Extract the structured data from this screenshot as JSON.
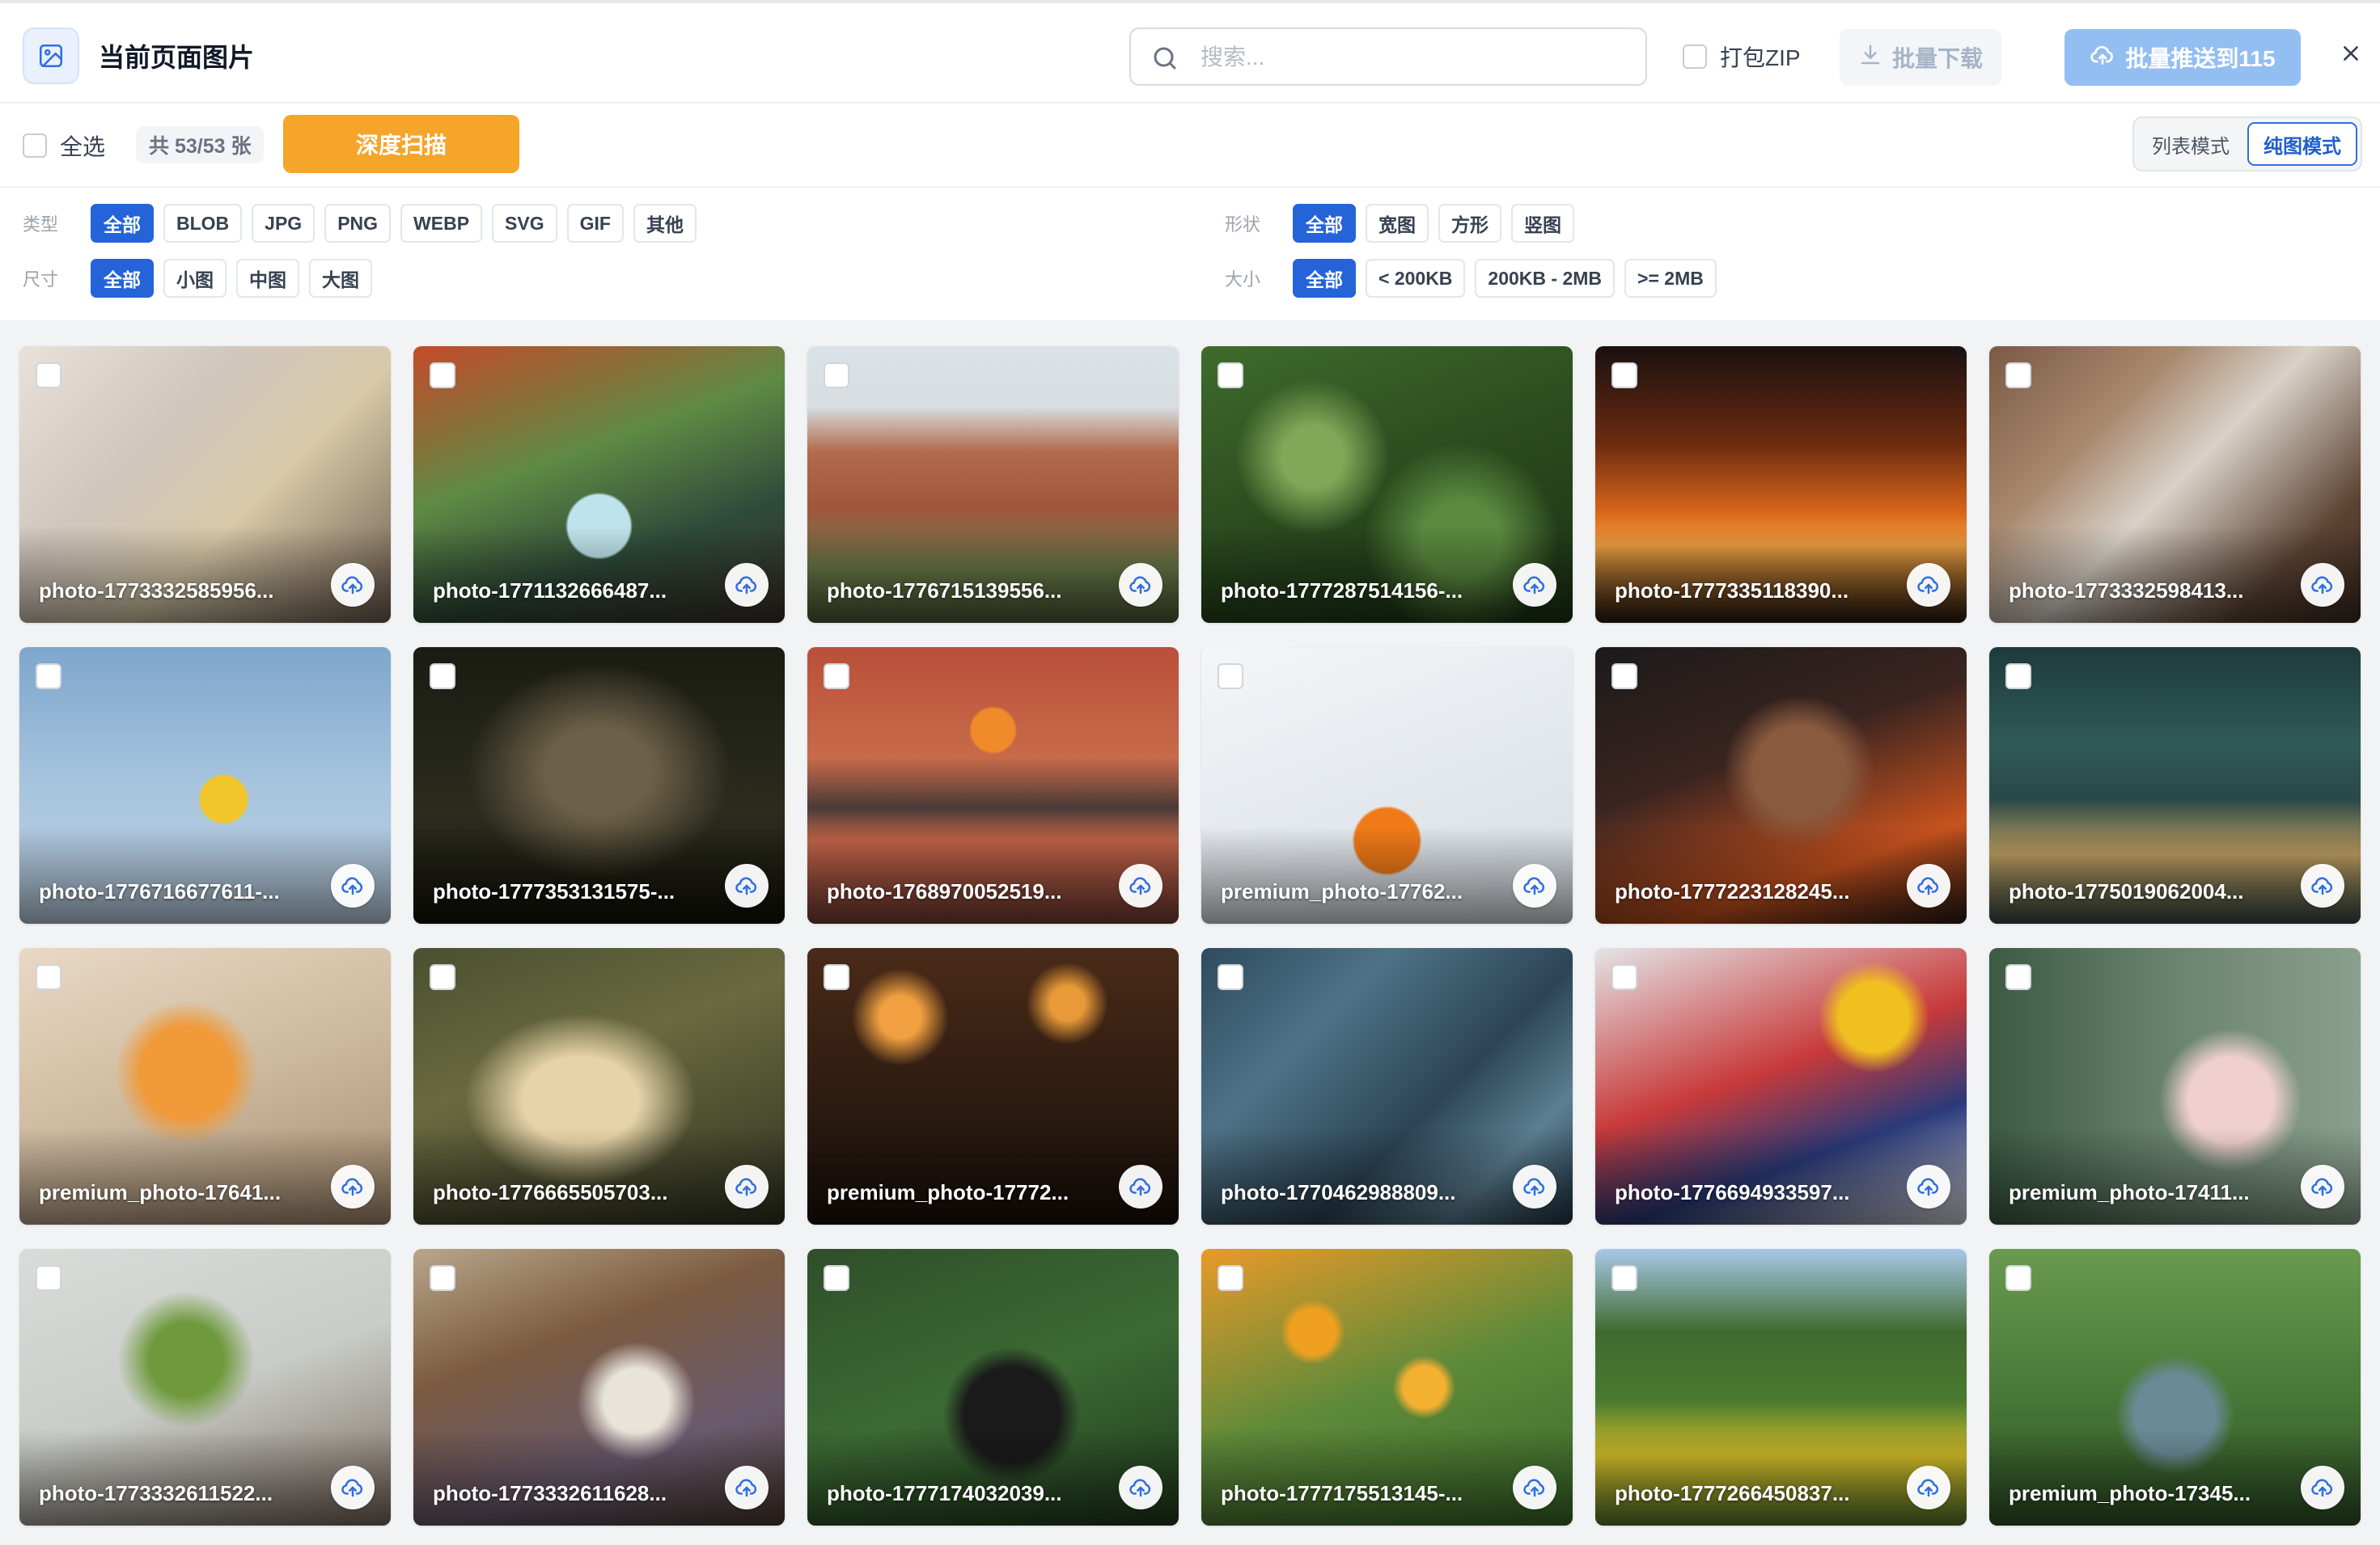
{
  "header": {
    "title": "当前页面图片",
    "logo_icon": "image-icon",
    "search_placeholder": "搜索...",
    "search_value": "",
    "zip_label": "打包ZIP",
    "download_label": "批量下载",
    "push_label": "批量推送到115",
    "close_icon": "close-icon"
  },
  "toolbar": {
    "select_all_label": "全选",
    "count_label": "共 53/53 张",
    "deep_scan_label": "深度扫描",
    "mode_list_label": "列表模式",
    "mode_grid_label": "纯图模式"
  },
  "filters": {
    "type": {
      "label": "类型",
      "options": [
        "全部",
        "BLOB",
        "JPG",
        "PNG",
        "WEBP",
        "SVG",
        "GIF",
        "其他"
      ],
      "selected": "全部"
    },
    "shape": {
      "label": "形状",
      "options": [
        "全部",
        "宽图",
        "方形",
        "竖图"
      ],
      "selected": "全部"
    },
    "dimension": {
      "label": "尺寸",
      "options": [
        "全部",
        "小图",
        "中图",
        "大图"
      ],
      "selected": "全部"
    },
    "filesize": {
      "label": "大小",
      "options": [
        "全部",
        "< 200KB",
        "200KB - 2MB",
        ">= 2MB"
      ],
      "selected": "全部"
    }
  },
  "colors": {
    "primary": "#2563d8",
    "orange": "#f5a52a",
    "push_button": "#93bef2"
  },
  "images": [
    {
      "name": "photo-1773332585956...",
      "bg": "linear-gradient(135deg,#e9e1da 0%,#cfc6bd 35%,#d8c9a8 60%,#6c5b4e 100%)"
    },
    {
      "name": "photo-1771132666487...",
      "bg": "radial-gradient(circle at 50% 65%,#bfe3ec 0 12%,transparent 13%),linear-gradient(160deg,#c44a2a 0%,#5f8a44 40%,#2e4a3a 70%,#3a2f26 100%)"
    },
    {
      "name": "photo-1776715139556...",
      "bg": "linear-gradient(180deg,#dbe3e8 0%,#d7dde0 22%,#b26b4c 38%,#a1563c 58%,#6b7b4a 80%,#4e5c36 100%)"
    },
    {
      "name": "photo-1777287514156-...",
      "bg": "radial-gradient(circle at 30% 40%,#7fa858 0 10%,transparent 25%),radial-gradient(circle at 70% 70%,#5b8a3f 0 12%,transparent 30%),linear-gradient(160deg,#3f6b2c 0%,#2a4a1e 50%,#1b3315 100%)"
    },
    {
      "name": "photo-1777335118390...",
      "bg": "linear-gradient(180deg,#1a1110 0%,#6b2a10 35%,#d9651a 60%,#f0a040 72%,#2a1a10 100%)"
    },
    {
      "name": "photo-1773332598413...",
      "bg": "linear-gradient(135deg,#7a5a44 0%,#a98a70 30%,#d9d2c8 50%,#5d4433 80%,#3b2a20 100%)"
    },
    {
      "name": "photo-1776716677611-...",
      "bg": "radial-gradient(circle at 55% 55%,#f1c62a 0 9%,transparent 10%),linear-gradient(180deg,#7ea6cc 0%,#a7c4de 50%,#bcd1e3 100%)"
    },
    {
      "name": "photo-1777353131575-...",
      "bg": "radial-gradient(ellipse at 50% 45%,#6d6048 0 20%,transparent 50%),linear-gradient(180deg,#1a1c12 0%,#2b2c1e 60%,#121208 100%)"
    },
    {
      "name": "photo-1768970052519...",
      "bg": "radial-gradient(circle at 50% 30%,#f08a2a 0 8%,transparent 9%),linear-gradient(180deg,#b9503a 0%,#c86a4a 40%,#4a3a38 58%,#c26448 70%,#7a3f36 100%)"
    },
    {
      "name": "premium_photo-17762...",
      "bg": "radial-gradient(circle at 50% 70%,#f07a18 0 12%,transparent 13%),linear-gradient(160deg,#f4f6f8 0%,#e4e9ee 50%,#d6dde3 100%)"
    },
    {
      "name": "photo-1777223128245...",
      "bg": "radial-gradient(circle at 55% 45%,#8a5a3e 0 18%,transparent 30%),linear-gradient(160deg,#1c1a1a 0%,#3a2420 40%,#c8521e 75%,#2a1a14 100%)"
    },
    {
      "name": "photo-1775019062004...",
      "bg": "linear-gradient(180deg,#1e3a3c 0%,#2f5a58 35%,#2a4848 55%,#c0a060 75%,#3a4a46 100%)"
    },
    {
      "name": "premium_photo-17641...",
      "bg": "radial-gradient(circle at 45% 45%,#f09a3a 0 18%,transparent 28%),linear-gradient(160deg,#e9d9c4 0%,#cdb99e 50%,#a68c70 100%)"
    },
    {
      "name": "photo-1776665505703...",
      "bg": "radial-gradient(ellipse at 45% 55%,#e7d3a8 0 20%,transparent 40%),linear-gradient(160deg,#4a5030 0%,#6a6a40 40%,#2f3320 100%)"
    },
    {
      "name": "premium_photo-17772...",
      "bg": "radial-gradient(circle at 25% 25%,#f0a040 0 6%,transparent 14%),radial-gradient(circle at 70% 20%,#e89a38 0 5%,transparent 12%),linear-gradient(180deg,#4a2a18 0%,#2a1a10 60%,#1a100a 100%)"
    },
    {
      "name": "photo-1770462988809...",
      "bg": "linear-gradient(135deg,#2e4a5e 0%,#4e7286 30%,#2c4556 60%,#5c7f92 80%,#1f3444 100%)"
    },
    {
      "name": "photo-1776694933597...",
      "bg": "radial-gradient(circle at 75% 25%,#f0c020 0 10%,transparent 16%),linear-gradient(160deg,#e4e4e6 0%,#c83a3a 45%,#2a3a7a 70%,#d9d9dc 100%)"
    },
    {
      "name": "premium_photo-17411...",
      "bg": "radial-gradient(circle at 65% 55%,#efcfcf 0 15%,transparent 25%),linear-gradient(90deg,#3c5a44 0%,#6a8470 50%,#8aa08e 100%)"
    },
    {
      "name": "photo-1773332611522...",
      "bg": "radial-gradient(circle at 45% 40%,#6e9a3c 0 14%,transparent 26%),linear-gradient(160deg,#d9dcd8 0%,#c9ccc7 50%,#7a6b5e 100%)"
    },
    {
      "name": "photo-1773332611628...",
      "bg": "radial-gradient(circle at 60% 55%,#e9e4da 0 12%,transparent 22%),linear-gradient(160deg,#b9a68a 0%,#7a5a40 35%,#6a5a6e 70%,#4a3a30 100%)"
    },
    {
      "name": "photo-1777174032039...",
      "bg": "radial-gradient(circle at 55% 60%,#1a1a1a 0 18%,transparent 26%),linear-gradient(160deg,#2f4f2a 0%,#3c6a34 50%,#1f3a1c 100%)"
    },
    {
      "name": "photo-1777175513145-...",
      "bg": "radial-gradient(circle at 30% 30%,#f0a020 0 7%,transparent 10%),radial-gradient(circle at 60% 50%,#f4b030 0 8%,transparent 12%),linear-gradient(160deg,#e89a28 0%,#5e8a3a 50%,#3a6a2a 100%)"
    },
    {
      "name": "photo-1777266450837...",
      "bg": "linear-gradient(180deg,#a8c8e8 0%,#3f6a2e 30%,#4a7a30 55%,#d8c028 75%,#5a7a2a 100%)"
    },
    {
      "name": "premium_photo-17345...",
      "bg": "radial-gradient(circle at 50% 60%,#6a8a96 0 16%,transparent 24%),linear-gradient(180deg,#6a9a4e 0%,#4a7a38 50%,#2e5226 100%)"
    }
  ]
}
